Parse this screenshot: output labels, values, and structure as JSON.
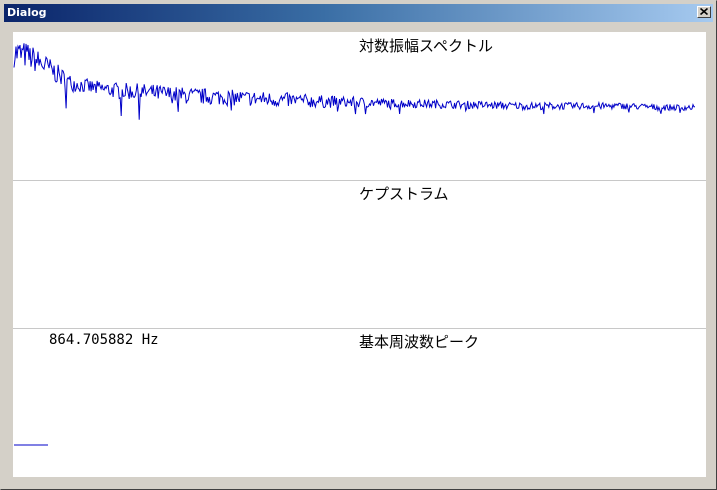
{
  "window": {
    "title": "Dialog"
  },
  "panels": {
    "spectrum": {
      "title": "対数振幅スペクトル"
    },
    "cepstrum": {
      "title": "ケプストラム"
    },
    "peak": {
      "title": "基本周波数ピーク",
      "frequency": "864.705882 Hz"
    }
  },
  "colors": {
    "trace": "#0000c8",
    "divider": "#c8c8c8",
    "titlebar_start": "#0a246a",
    "titlebar_end": "#a6caf0"
  },
  "chart_data": {
    "type": "line",
    "title": "対数振幅スペクトル",
    "xlabel": "",
    "ylabel": "",
    "grid": false,
    "legend": "none",
    "x_range": [
      0,
      1
    ],
    "y_range": [
      0,
      1
    ],
    "series": [
      {
        "trend": [
          [
            0.0,
            0.86
          ],
          [
            0.02,
            0.84
          ],
          [
            0.05,
            0.76
          ],
          [
            0.08,
            0.66
          ],
          [
            0.12,
            0.62
          ],
          [
            0.16,
            0.6
          ],
          [
            0.2,
            0.59
          ],
          [
            0.25,
            0.57
          ],
          [
            0.3,
            0.56
          ],
          [
            0.35,
            0.55
          ],
          [
            0.4,
            0.54
          ],
          [
            0.45,
            0.53
          ],
          [
            0.5,
            0.525
          ],
          [
            0.55,
            0.52
          ],
          [
            0.6,
            0.515
          ],
          [
            0.65,
            0.51
          ],
          [
            0.7,
            0.505
          ],
          [
            0.75,
            0.5
          ],
          [
            0.8,
            0.5
          ],
          [
            0.85,
            0.5
          ],
          [
            0.9,
            0.5
          ],
          [
            0.95,
            0.49
          ],
          [
            1.0,
            0.49
          ]
        ],
        "noise_amplitude": [
          [
            0.0,
            0.1
          ],
          [
            0.06,
            0.07
          ],
          [
            0.1,
            0.05
          ],
          [
            0.2,
            0.06
          ],
          [
            0.4,
            0.05
          ],
          [
            0.55,
            0.03
          ],
          [
            0.75,
            0.025
          ],
          [
            1.0,
            0.02
          ]
        ]
      }
    ]
  }
}
